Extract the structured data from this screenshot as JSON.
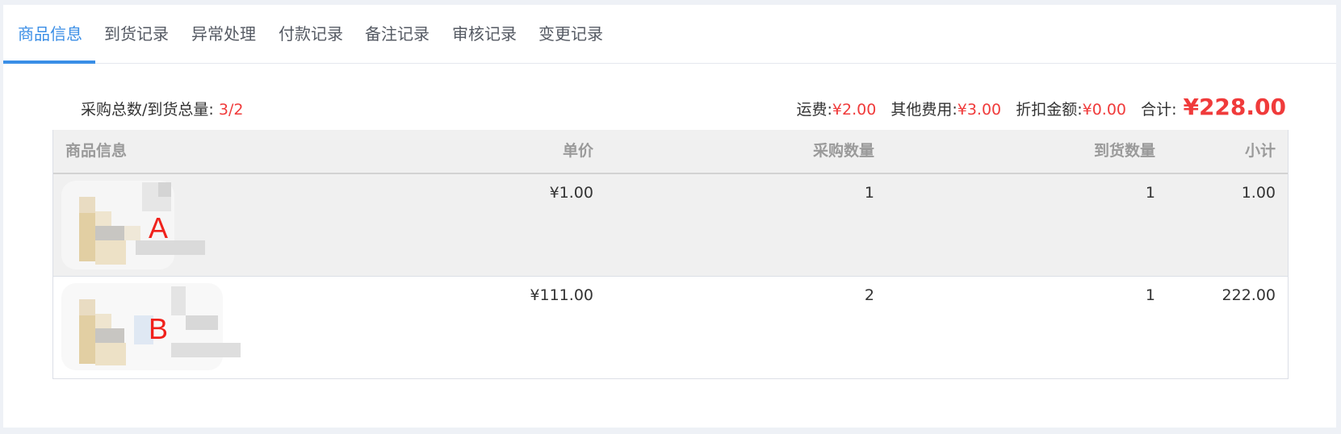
{
  "tabs": [
    {
      "label": "商品信息",
      "active": true
    },
    {
      "label": "到货记录",
      "active": false
    },
    {
      "label": "异常处理",
      "active": false
    },
    {
      "label": "付款记录",
      "active": false
    },
    {
      "label": "备注记录",
      "active": false
    },
    {
      "label": "审核记录",
      "active": false
    },
    {
      "label": "变更记录",
      "active": false
    }
  ],
  "summary": {
    "qty_label": "采购总数/到货总量:",
    "qty_value": "3/2",
    "freight_label": "运费:",
    "freight_value": "¥2.00",
    "other_label": "其他费用:",
    "other_value": "¥3.00",
    "discount_label": "折扣金额:",
    "discount_value": "¥0.00",
    "total_label": "合计:",
    "total_value": "¥228.00"
  },
  "table": {
    "headers": {
      "product": "商品信息",
      "unit_price": "单价",
      "purchase_qty": "采购数量",
      "arrival_qty": "到货数量",
      "subtotal": "小计"
    },
    "rows": [
      {
        "thumb_label": "A",
        "unit_price": "¥1.00",
        "purchase_qty": "1",
        "arrival_qty": "1",
        "subtotal": "1.00"
      },
      {
        "thumb_label": "B",
        "unit_price": "¥111.00",
        "purchase_qty": "2",
        "arrival_qty": "1",
        "subtotal": "222.00"
      }
    ]
  },
  "colors": {
    "accent": "#3a8ee6",
    "price_red": "#f03b3b",
    "thumb_label_red": "#f0221c"
  }
}
